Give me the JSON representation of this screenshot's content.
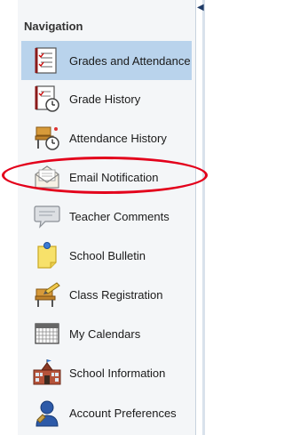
{
  "navigation": {
    "title": "Navigation",
    "items": [
      {
        "label": "Grades and Attendance",
        "icon": "grades-book-icon",
        "active": true
      },
      {
        "label": "Grade History",
        "icon": "grade-history-clock-icon"
      },
      {
        "label": "Attendance History",
        "icon": "attendance-desk-clock-icon"
      },
      {
        "label": "Email Notification",
        "icon": "email-envelope-icon"
      },
      {
        "label": "Teacher Comments",
        "icon": "comment-bubble-icon"
      },
      {
        "label": "School Bulletin",
        "icon": "bulletin-note-icon"
      },
      {
        "label": "Class Registration",
        "icon": "class-desk-pencil-icon"
      },
      {
        "label": "My Calendars",
        "icon": "calendar-grid-icon"
      },
      {
        "label": "School Information",
        "icon": "school-building-icon"
      },
      {
        "label": "Account Preferences",
        "icon": "account-person-icon"
      }
    ]
  },
  "annotation": {
    "highlight_color": "#e3001b"
  },
  "colors": {
    "active_bg": "#b9d3ec",
    "panel_bg": "#f4f6f8"
  }
}
